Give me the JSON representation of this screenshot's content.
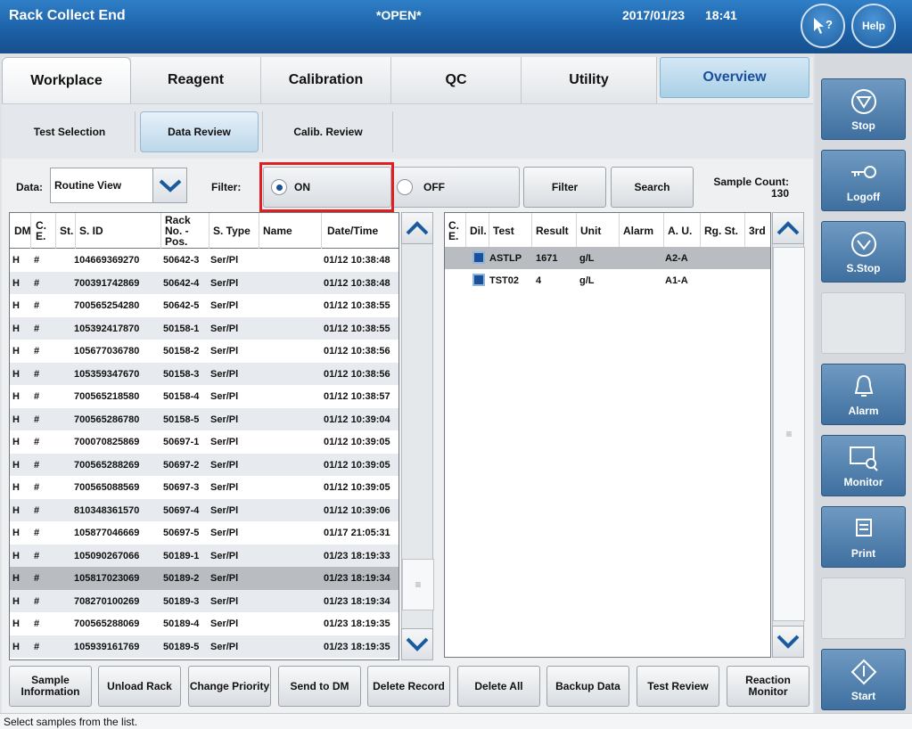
{
  "header": {
    "title": "Rack Collect End",
    "mode": "*OPEN*",
    "date": "2017/01/23",
    "time": "18:41",
    "whatsthis_label": "?",
    "help_label": "Help"
  },
  "main_tabs": [
    "Workplace",
    "Reagent",
    "Calibration",
    "QC",
    "Utility",
    "Overview"
  ],
  "sub_tabs": [
    "Test Selection",
    "Data Review",
    "Calib. Review"
  ],
  "filter_bar": {
    "data_label": "Data:",
    "data_value": "Routine View",
    "filter_label": "Filter:",
    "on_label": "ON",
    "off_label": "OFF",
    "filter_button": "Filter",
    "search_button": "Search",
    "sample_count_label": "Sample Count:",
    "sample_count": "130"
  },
  "sample_table": {
    "columns": [
      "DM",
      "C. E.",
      "St.",
      "S. ID",
      "Rack No. - Pos.",
      "S. Type",
      "Name",
      "Date/Time"
    ],
    "rows": [
      {
        "dm": "H",
        "ce": "#",
        "sid": "104669369270",
        "rack": "50642-3",
        "stype": "Ser/Pl",
        "dt": "01/12 10:38:48"
      },
      {
        "dm": "H",
        "ce": "#",
        "sid": "700391742869",
        "rack": "50642-4",
        "stype": "Ser/Pl",
        "dt": "01/12 10:38:48"
      },
      {
        "dm": "H",
        "ce": "#",
        "sid": "700565254280",
        "rack": "50642-5",
        "stype": "Ser/Pl",
        "dt": "01/12 10:38:55"
      },
      {
        "dm": "H",
        "ce": "#",
        "sid": "105392417870",
        "rack": "50158-1",
        "stype": "Ser/Pl",
        "dt": "01/12 10:38:55"
      },
      {
        "dm": "H",
        "ce": "#",
        "sid": "105677036780",
        "rack": "50158-2",
        "stype": "Ser/Pl",
        "dt": "01/12 10:38:56"
      },
      {
        "dm": "H",
        "ce": "#",
        "sid": "105359347670",
        "rack": "50158-3",
        "stype": "Ser/Pl",
        "dt": "01/12 10:38:56"
      },
      {
        "dm": "H",
        "ce": "#",
        "sid": "700565218580",
        "rack": "50158-4",
        "stype": "Ser/Pl",
        "dt": "01/12 10:38:57"
      },
      {
        "dm": "H",
        "ce": "#",
        "sid": "700565286780",
        "rack": "50158-5",
        "stype": "Ser/Pl",
        "dt": "01/12 10:39:04"
      },
      {
        "dm": "H",
        "ce": "#",
        "sid": "700070825869",
        "rack": "50697-1",
        "stype": "Ser/Pl",
        "dt": "01/12 10:39:05"
      },
      {
        "dm": "H",
        "ce": "#",
        "sid": "700565288269",
        "rack": "50697-2",
        "stype": "Ser/Pl",
        "dt": "01/12 10:39:05"
      },
      {
        "dm": "H",
        "ce": "#",
        "sid": "700565088569",
        "rack": "50697-3",
        "stype": "Ser/Pl",
        "dt": "01/12 10:39:05"
      },
      {
        "dm": "H",
        "ce": "#",
        "sid": "810348361570",
        "rack": "50697-4",
        "stype": "Ser/Pl",
        "dt": "01/12 10:39:06"
      },
      {
        "dm": "H",
        "ce": "#",
        "sid": "105877046669",
        "rack": "50697-5",
        "stype": "Ser/Pl",
        "dt": "01/17 21:05:31"
      },
      {
        "dm": "H",
        "ce": "#",
        "sid": "105090267066",
        "rack": "50189-1",
        "stype": "Ser/Pl",
        "dt": "01/23 18:19:33"
      },
      {
        "dm": "H",
        "ce": "#",
        "sid": "105817023069",
        "rack": "50189-2",
        "stype": "Ser/Pl",
        "dt": "01/23 18:19:34"
      },
      {
        "dm": "H",
        "ce": "#",
        "sid": "708270100269",
        "rack": "50189-3",
        "stype": "Ser/Pl",
        "dt": "01/23 18:19:34"
      },
      {
        "dm": "H",
        "ce": "#",
        "sid": "700565288069",
        "rack": "50189-4",
        "stype": "Ser/Pl",
        "dt": "01/23 18:19:35"
      },
      {
        "dm": "H",
        "ce": "#",
        "sid": "105939161769",
        "rack": "50189-5",
        "stype": "Ser/Pl",
        "dt": "01/23 18:19:35"
      }
    ]
  },
  "result_table": {
    "columns": [
      "C. E.",
      "Dil.",
      "Test",
      "Result",
      "Unit",
      "Alarm",
      "A. U.",
      "Rg. St.",
      "3rd"
    ],
    "rows": [
      {
        "test": "ASTLP",
        "result": "1671",
        "unit": "g/L",
        "au": "A2-A"
      },
      {
        "test": "TST02",
        "result": "4",
        "unit": "g/L",
        "au": "A1-A"
      }
    ]
  },
  "bottom_buttons": [
    "Sample Information",
    "Unload Rack",
    "Change Priority",
    "Send to DM",
    "Delete Record",
    "Delete All",
    "Backup Data",
    "Test Review",
    "Reaction Monitor"
  ],
  "side_buttons": [
    "Stop",
    "Logoff",
    "S.Stop",
    "",
    "Alarm",
    "Monitor",
    "Print",
    "",
    "Start"
  ],
  "status_text": "Select samples from the list."
}
